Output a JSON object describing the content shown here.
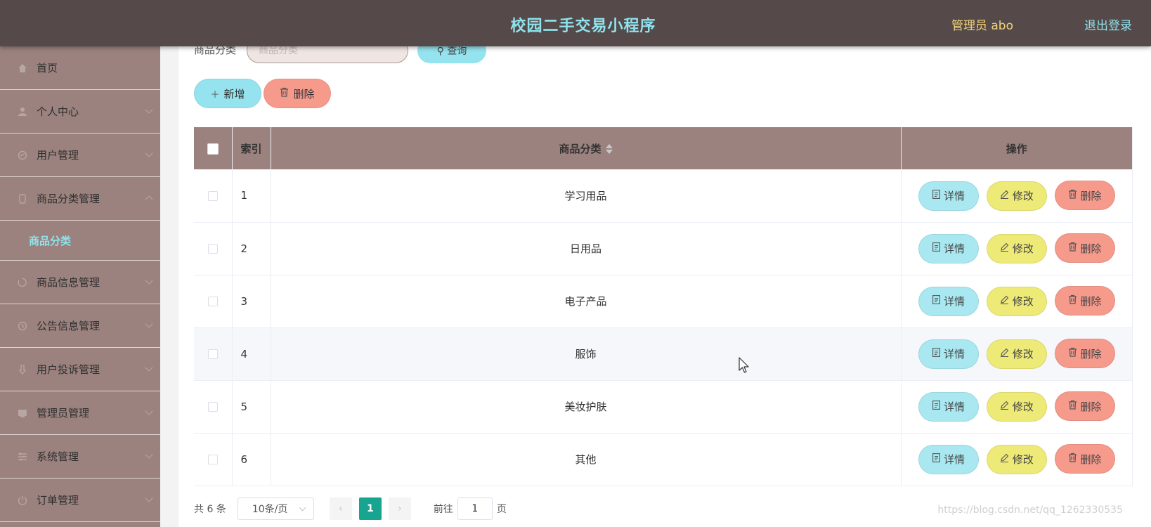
{
  "header": {
    "title": "校园二手交易小程序",
    "admin_label": "管理员 abo",
    "logout_label": "退出登录"
  },
  "sidebar": {
    "items": [
      {
        "label": "首页",
        "icon": "home-icon"
      },
      {
        "label": "个人中心",
        "icon": "user-icon"
      },
      {
        "label": "用户管理",
        "icon": "users-icon"
      },
      {
        "label": "商品分类管理",
        "icon": "category-icon"
      },
      {
        "label": "商品信息管理",
        "icon": "goods-icon"
      },
      {
        "label": "公告信息管理",
        "icon": "notice-icon"
      },
      {
        "label": "用户投诉管理",
        "icon": "complaint-icon"
      },
      {
        "label": "管理员管理",
        "icon": "admin-icon"
      },
      {
        "label": "系统管理",
        "icon": "system-icon"
      },
      {
        "label": "订单管理",
        "icon": "order-icon"
      }
    ],
    "active_sub": "商品分类"
  },
  "search": {
    "label": "商品分类",
    "placeholder": "商品分类",
    "button_label": "查询"
  },
  "toolbar": {
    "add_label": "新增",
    "delete_label": "删除"
  },
  "table": {
    "headers": {
      "index": "索引",
      "category": "商品分类",
      "actions": "操作"
    },
    "rows": [
      {
        "index": "1",
        "category": "学习用品"
      },
      {
        "index": "2",
        "category": "日用品"
      },
      {
        "index": "3",
        "category": "电子产品"
      },
      {
        "index": "4",
        "category": "服饰"
      },
      {
        "index": "5",
        "category": "美妆护肤"
      },
      {
        "index": "6",
        "category": "其他"
      }
    ],
    "row_actions": {
      "detail": "详情",
      "edit": "修改",
      "delete": "删除"
    }
  },
  "pagination": {
    "total": "共 6 条",
    "page_size": "10条/页",
    "current_page": "1",
    "goto_label": "前往",
    "goto_value": "1",
    "page_unit": "页"
  },
  "watermark": "https://blog.csdn.net/qq_1262330535",
  "colors": {
    "header_bg": "#554a49",
    "sidebar_bg": "#9b827e",
    "accent_cyan": "#95e3ee",
    "accent_red": "#f69a8c",
    "accent_yellow": "#eeea77",
    "page_active": "#17a590"
  }
}
